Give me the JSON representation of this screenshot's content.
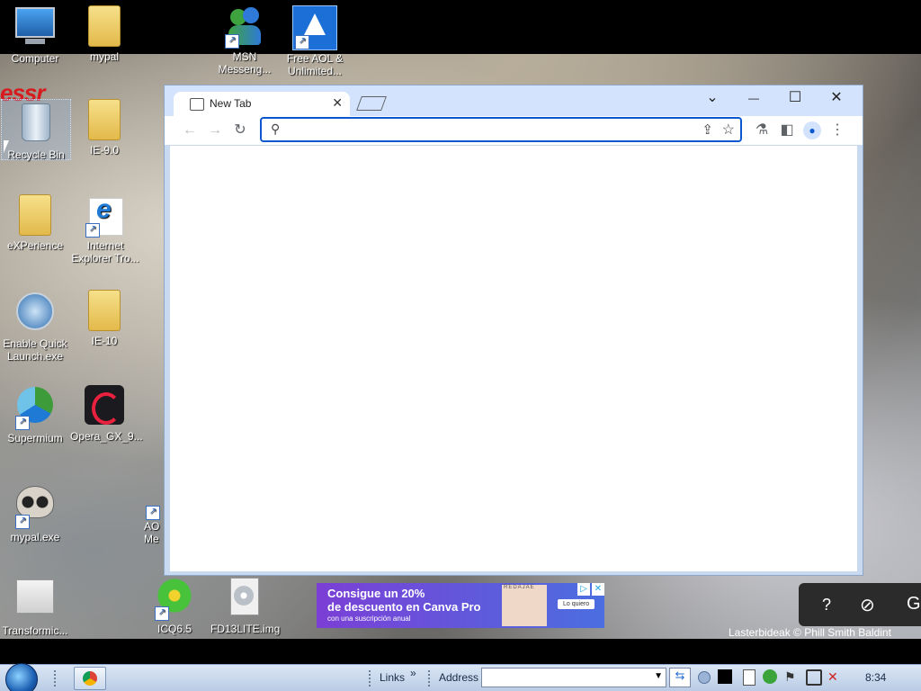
{
  "desktop": {
    "icons": [
      {
        "label": "Computer"
      },
      {
        "label": "mypal"
      },
      {
        "label": "MSN Messeng..."
      },
      {
        "label": "Free AOL & Unlimited..."
      },
      {
        "label": "Recycle Bin"
      },
      {
        "label": "IE-9.0"
      },
      {
        "label": "eXPerience"
      },
      {
        "label": "Internet Explorer Tro..."
      },
      {
        "label": "Enable Quick Launch.exe"
      },
      {
        "label": "IE-10"
      },
      {
        "label": "Supermium"
      },
      {
        "label": "Opera_GX_9..."
      },
      {
        "label": "mypal.exe"
      },
      {
        "label": "AO Me"
      },
      {
        "label": "Transformic..."
      },
      {
        "label": "ICQ6.5"
      },
      {
        "label": "FD13LITE.img"
      }
    ],
    "partial_text": "essr",
    "attribution": "Lasterbideak © Phill Smith  Baldint"
  },
  "browser": {
    "tab_title": "New Tab",
    "tab_close": "✕",
    "window_controls": {
      "dropdown": "⌄",
      "minimize": "—",
      "maximize": "☐",
      "close": "✕"
    },
    "nav": {
      "back": "←",
      "forward": "→",
      "reload": "↻"
    },
    "omnibox": {
      "value": "",
      "search_glyph": "⚲"
    },
    "toolbar_icons": {
      "share": "⇪",
      "bookmark": "☆",
      "labs": "⚗",
      "sidepanel": "◧",
      "profile": "●",
      "menu": "⋮"
    }
  },
  "ad": {
    "line1": "Consigue un 20%",
    "line2": "de descuento en Canva Pro",
    "line3": "con una suscripción anual",
    "cta": "Lo quiero",
    "brand": "REDAJAE"
  },
  "right_panel": {
    "help": "?",
    "compass": "⊘",
    "partial": "G"
  },
  "taskbar": {
    "links": "Links",
    "chevrons": "»",
    "address_label": "Address",
    "address_value": "",
    "go": "⇆",
    "clock": "8:34"
  },
  "colors": {
    "accent": "#0b57d0",
    "tabstrip": "#d3e3fd",
    "taskbar": "#c7d6ec"
  }
}
